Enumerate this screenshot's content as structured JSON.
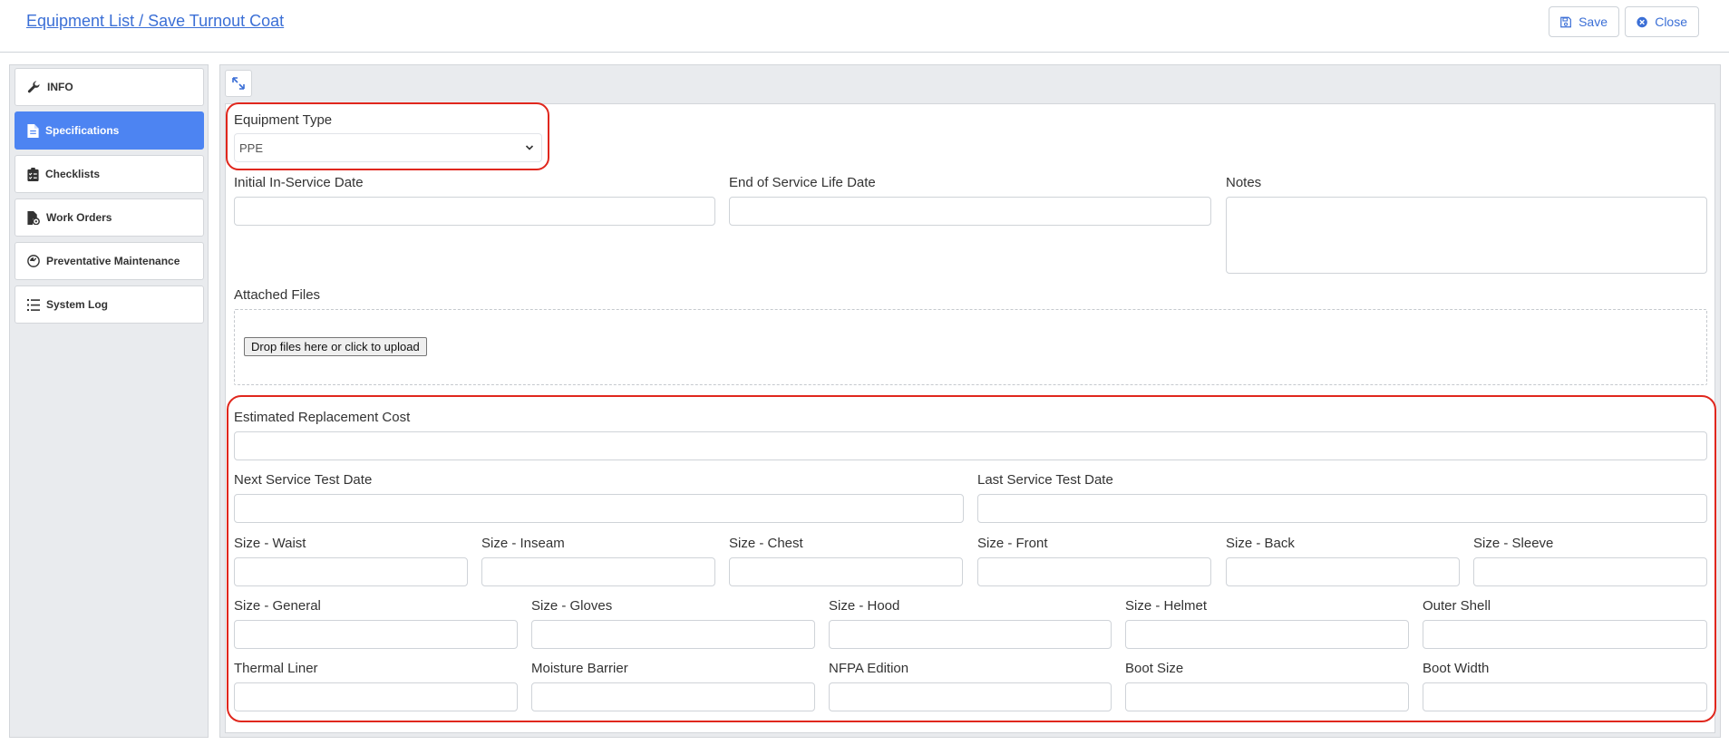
{
  "header": {
    "title": "Equipment List / Save Turnout Coat",
    "save_label": "Save",
    "close_label": "Close",
    "accent_color": "#3b6fd6"
  },
  "sidebar": {
    "active_color": "#4d84f2",
    "items": [
      {
        "label": "INFO",
        "icon": "wrench-icon"
      },
      {
        "label": "Specifications",
        "icon": "document-icon"
      },
      {
        "label": "Checklists",
        "icon": "checklist-icon"
      },
      {
        "label": "Work Orders",
        "icon": "work-order-icon"
      },
      {
        "label": "Preventative Maintenance",
        "icon": "gauge-icon"
      },
      {
        "label": "System Log",
        "icon": "list-icon"
      }
    ]
  },
  "form": {
    "equipment_type": {
      "label": "Equipment Type",
      "value": "PPE"
    },
    "initial_in_service_date": {
      "label": "Initial In-Service Date",
      "value": ""
    },
    "end_of_service_life_date": {
      "label": "End of Service Life Date",
      "value": ""
    },
    "notes": {
      "label": "Notes",
      "value": ""
    },
    "attached_files": {
      "label": "Attached Files",
      "upload_label": "Drop files here or click to upload"
    },
    "estimated_replacement_cost": {
      "label": "Estimated Replacement Cost",
      "value": ""
    },
    "next_service_test_date": {
      "label": "Next Service Test Date",
      "value": ""
    },
    "last_service_test_date": {
      "label": "Last Service Test Date",
      "value": ""
    },
    "size_row": [
      {
        "label": "Size - Waist",
        "value": ""
      },
      {
        "label": "Size - Inseam",
        "value": ""
      },
      {
        "label": "Size - Chest",
        "value": ""
      },
      {
        "label": "Size - Front",
        "value": ""
      },
      {
        "label": "Size - Back",
        "value": ""
      },
      {
        "label": "Size - Sleeve",
        "value": ""
      }
    ],
    "gear_row": [
      {
        "label": "Size - General",
        "value": ""
      },
      {
        "label": "Size - Gloves",
        "value": ""
      },
      {
        "label": "Size - Hood",
        "value": ""
      },
      {
        "label": "Size - Helmet",
        "value": ""
      },
      {
        "label": "Outer Shell",
        "value": ""
      }
    ],
    "material_row": [
      {
        "label": "Thermal Liner",
        "value": ""
      },
      {
        "label": "Moisture Barrier",
        "value": ""
      },
      {
        "label": "NFPA Edition",
        "value": ""
      },
      {
        "label": "Boot Size",
        "value": ""
      },
      {
        "label": "Boot Width",
        "value": ""
      }
    ]
  },
  "highlight_color": "#e0271d"
}
